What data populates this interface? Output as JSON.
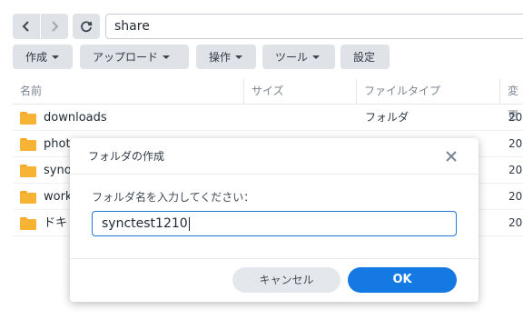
{
  "nav": {
    "back_icon": "chevron-left-icon",
    "forward_icon": "chevron-right-icon",
    "refresh_icon": "refresh-icon",
    "path": "share"
  },
  "toolbar": {
    "create_label": "作成",
    "upload_label": "アップロード",
    "action_label": "操作",
    "tools_label": "ツール",
    "settings_label": "設定"
  },
  "table": {
    "columns": [
      "名前",
      "サイズ",
      "ファイルタイプ",
      "変更"
    ],
    "rows": [
      {
        "name": "downloads",
        "type": "フォルダ",
        "date": "20"
      },
      {
        "name": "phot",
        "type": "",
        "date": "20"
      },
      {
        "name": "syno",
        "type": "",
        "date": "20"
      },
      {
        "name": "work",
        "type": "",
        "date": "20"
      },
      {
        "name": "ドキ",
        "type": "",
        "date": "20"
      }
    ]
  },
  "dialog": {
    "title": "フォルダの作成",
    "label": "フォルダ名を入力してください：",
    "input_value": "synctest1210",
    "cancel_label": "キャンセル",
    "ok_label": "OK"
  },
  "colors": {
    "accent": "#1479e3",
    "folder": "#f7b333",
    "button_bg": "#dfe3e8"
  }
}
